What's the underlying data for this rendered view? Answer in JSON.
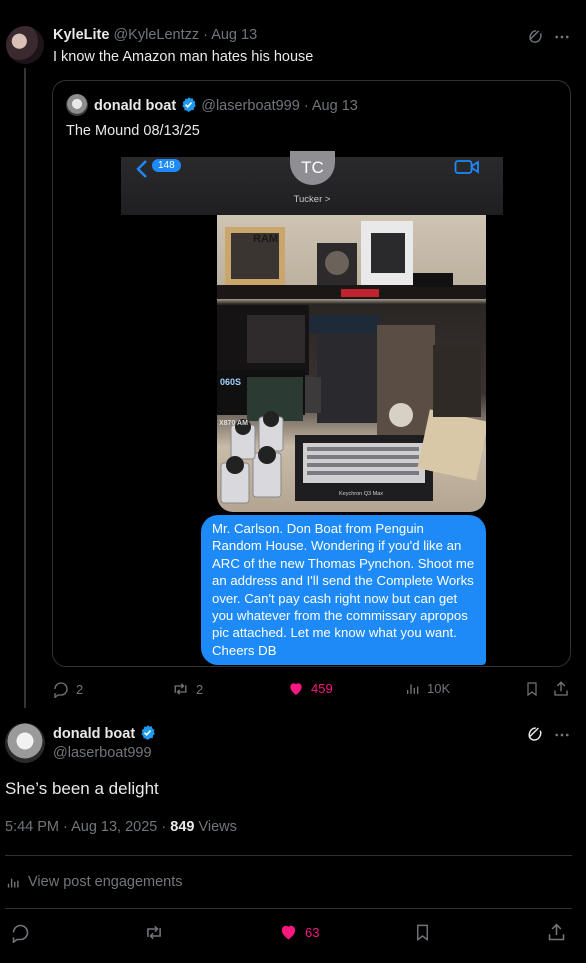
{
  "colors": {
    "accent": "#1d9bf0",
    "like": "#f91880",
    "imessage_blue": "#1d8af7"
  },
  "reply_tweet": {
    "display_name": "KyleLite",
    "handle": "@KyleLentzz",
    "date": "· Aug 13",
    "text": "I know the Amazon man hates his house",
    "stats": {
      "replies": "2",
      "reposts": "2",
      "likes": "459",
      "views": "10K"
    }
  },
  "quoted_tweet": {
    "display_name": "donald boat",
    "handle": "@laserboat999",
    "date": "· Aug 13",
    "text": "The Mound 08/13/25",
    "screenshot": {
      "back_count": "148",
      "contact_initials": "TC",
      "contact_name": "Tucker >",
      "poster_texts": {
        "ram": "RAM",
        "gpu_label": "060S",
        "board_label": "X870 AM",
        "keyboard_brand": "Keychron Q3 Max"
      },
      "message": "Mr. Carlson. Don Boat from Penguin Random House. Wondering if you'd like an ARC of the new Thomas Pynchon. Shoot me an address and I'll send the Complete Works over. Can't pay cash right now but can get you whatever from the commissary apropos pic attached. Let me know what you want. Cheers DB"
    }
  },
  "main_tweet": {
    "display_name": "donald boat",
    "handle": "@laserboat999",
    "text": "She’s been a delight",
    "timestamp": "5:44 PM · Aug 13, 2025 ·",
    "view_count": "849",
    "views_label": "Views",
    "engagements_label": "View post engagements",
    "likes": "63"
  },
  "icons": [
    "grok-icon",
    "more-icon",
    "reply-icon",
    "repost-icon",
    "like-icon",
    "views-icon",
    "bookmark-icon",
    "share-icon",
    "verified-icon",
    "analytics-icon"
  ]
}
